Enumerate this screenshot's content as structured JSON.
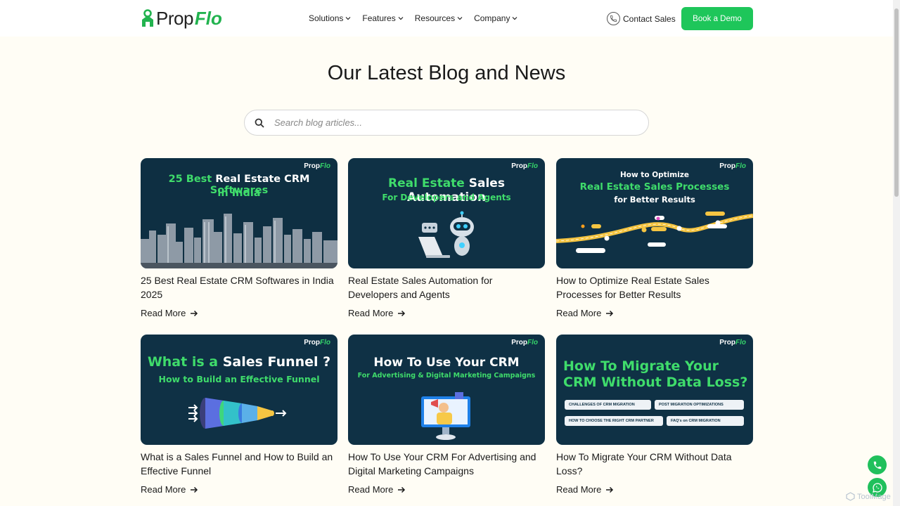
{
  "brand": {
    "name_prefix": "Prop",
    "name_suffix": "Flo",
    "green": "#1ec65a",
    "navy": "#0f3145"
  },
  "nav": {
    "menu": [
      "Solutions",
      "Features",
      "Resources",
      "Company"
    ],
    "contact_label": "Contact Sales",
    "demo_label": "Book a Demo"
  },
  "page": {
    "title": "Our Latest Blog and News"
  },
  "search": {
    "placeholder": "Search blog articles..."
  },
  "posts": [
    {
      "title": "25 Best Real Estate CRM Softwares in India 2025",
      "thumb_line1a": "25 Best",
      "thumb_line1b": "Real Estate CRM",
      "thumb_line1c": "Softwares",
      "thumb_line2": "in India",
      "read_more": "Read More"
    },
    {
      "title": "Real Estate Sales Automation for Developers and Agents",
      "thumb_line1a": "Real Estate",
      "thumb_line1b": "Sales Automation",
      "thumb_line2": "For Developers and Agents",
      "read_more": "Read More"
    },
    {
      "title": "How to Optimize Real Estate Sales Processes for Better Results",
      "thumb_line1": "How to Optimize",
      "thumb_line2": "Real Estate Sales Processes",
      "thumb_line3": "for Better Results",
      "read_more": "Read More"
    },
    {
      "title": "What is a Sales Funnel and How to Build an Effective Funnel",
      "thumb_line1a": "What is a",
      "thumb_line1b": "Sales Funnel ?",
      "thumb_line2": "How to Build an Effective Funnel",
      "read_more": "Read More"
    },
    {
      "title": "How To Use Your CRM For Advertising and Digital Marketing Campaigns",
      "thumb_line1": "How To Use Your CRM",
      "thumb_line2": "For Advertising & Digital Marketing Campaigns",
      "read_more": "Read More"
    },
    {
      "title": "How To Migrate Your CRM Without Data Loss?",
      "thumb_line1": "How To Migrate Your",
      "thumb_line2": "CRM Without Data Loss?",
      "thumb_chips": [
        "CHALLENGES OF CRM MIGRATION",
        "POST MIGRATION OPTIMIZATIONS",
        "HOW TO CHOOSE THE RIGHT CRM PARTNER",
        "FAQ's on CRM MIGRATION"
      ],
      "read_more": "Read More"
    }
  ],
  "thumb_logo": {
    "prefix": "Prop",
    "suffix": "Flo"
  },
  "watermark": "ToolMage"
}
